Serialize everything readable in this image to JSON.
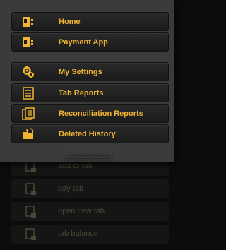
{
  "menu": {
    "items": [
      {
        "label": "Home",
        "icon": "home-icon"
      },
      {
        "label": "Payment App",
        "icon": "payment-app-icon"
      },
      {
        "label": "My Settings",
        "icon": "settings-icon"
      },
      {
        "label": "Tab Reports",
        "icon": "report-icon"
      },
      {
        "label": "Reconciliation Reports",
        "icon": "reconciliation-report-icon"
      },
      {
        "label": "Deleted History",
        "icon": "deleted-history-icon"
      }
    ]
  },
  "background": {
    "items": [
      {
        "label": "add to tab"
      },
      {
        "label": "pay tab"
      },
      {
        "label": "open new tab"
      },
      {
        "label": "tab balance"
      }
    ]
  },
  "colors": {
    "accent": "#f2b531",
    "drawer_bg": "#3b3b3b",
    "item_bg": "#1f1f1f",
    "page_bg": "#0c0c0c"
  }
}
